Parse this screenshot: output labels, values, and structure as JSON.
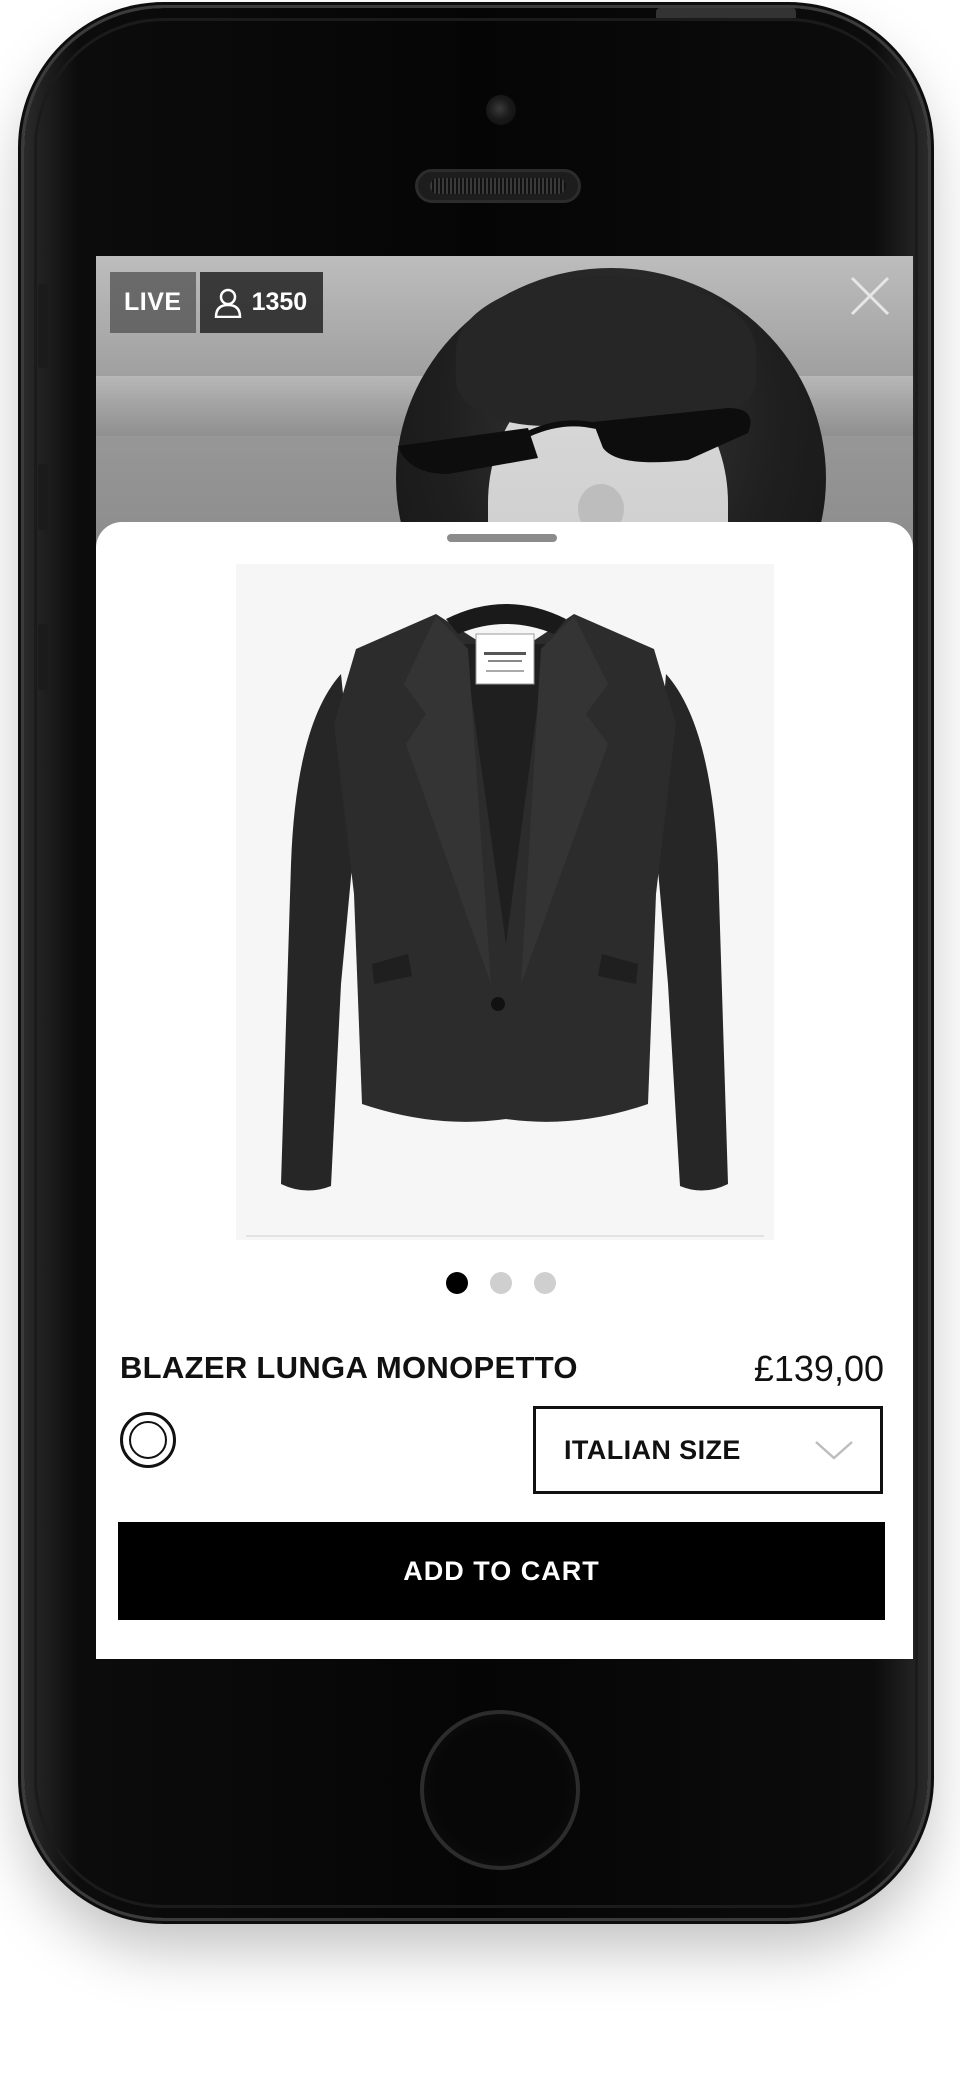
{
  "live_badge": {
    "live_label": "LIVE",
    "viewer_count": "1350"
  },
  "product": {
    "name": "BLAZER LUNGA MONOPETTO",
    "price": "£139,00",
    "image_dots": {
      "count": 3,
      "active_index": 0
    }
  },
  "size_select": {
    "label": "ITALIAN SIZE"
  },
  "actions": {
    "add_to_cart": "ADD TO CART"
  }
}
